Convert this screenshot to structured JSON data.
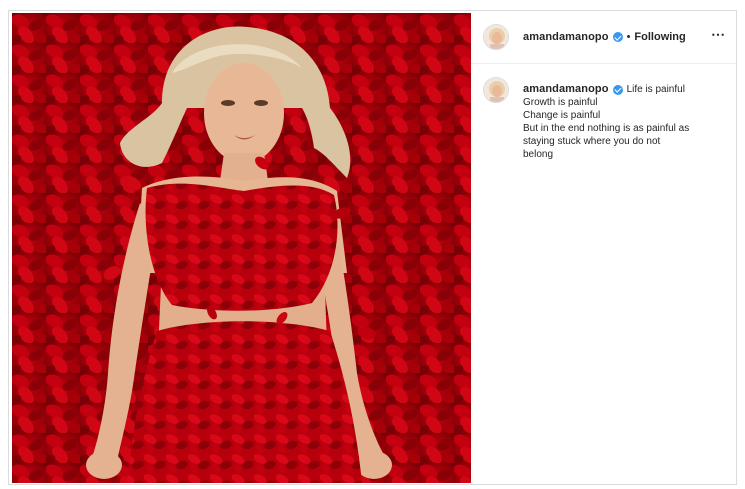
{
  "post": {
    "username": "amandamanopo",
    "verified": true,
    "separator": "•",
    "follow_status": "Following",
    "more_icon": "⋯"
  },
  "caption": {
    "username": "amandamanopo",
    "lines": [
      "Life is painful",
      "Growth is painful",
      "Change is painful",
      "But in the end nothing is as painful as",
      "staying stuck where you do not",
      "belong"
    ]
  },
  "colors": {
    "verified_badge": "#3897f0",
    "rose_red": "#b3000c",
    "border": "#dbdbdb"
  }
}
